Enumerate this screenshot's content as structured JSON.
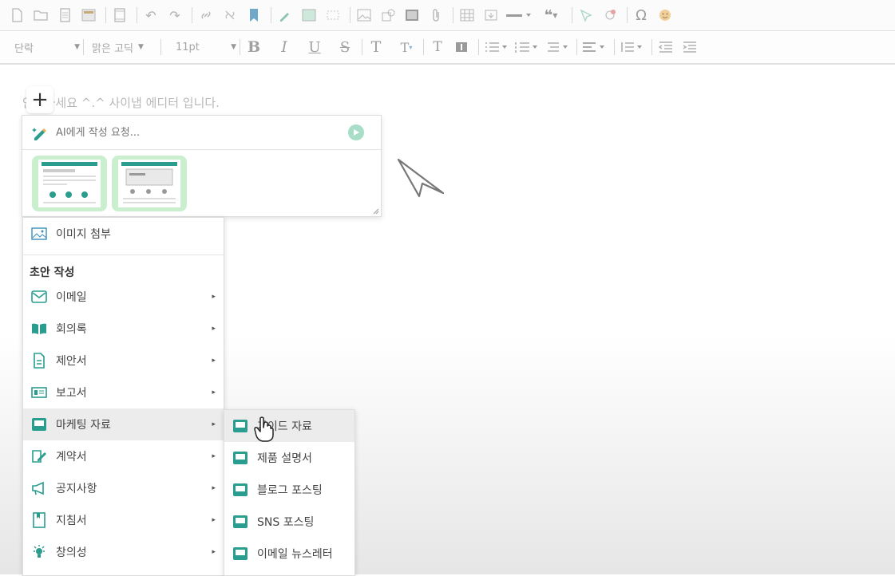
{
  "toolbar": {
    "row1_icons": [
      "new-document-icon",
      "open-folder-icon",
      "document-icon",
      "template-icon",
      "page-layout-icon",
      "undo-icon",
      "redo-icon",
      "link-icon",
      "unlink-icon",
      "bookmark-icon",
      "ai-write-icon",
      "image-insert-icon",
      "crop-icon",
      "picture-icon",
      "shapes-icon",
      "video-icon",
      "attachment-icon",
      "table-icon",
      "embed-icon",
      "horizontal-rule-icon",
      "quote-icon",
      "tag-icon",
      "special-char-icon",
      "emoji-icon"
    ],
    "paragraph_style": "단락",
    "font_family": "맑은 고딕",
    "font_size": "11pt"
  },
  "editor": {
    "placeholder_text": "안녕하세요 ^.^ 사이냅 에디터 입니다.",
    "add_block_symbol": "+"
  },
  "ai_panel": {
    "input_placeholder": "AI에게 작성 요청...",
    "colors": {
      "accent": "#2a9d8f",
      "thumb_bg": "#c9efcf",
      "send": "#a8dec8"
    }
  },
  "menu": {
    "attach_image": "이미지 첨부",
    "section_title": "초안 작성",
    "items": [
      {
        "label": "이메일",
        "icon": "mail-icon"
      },
      {
        "label": "회의록",
        "icon": "book-icon"
      },
      {
        "label": "제안서",
        "icon": "proposal-doc-icon"
      },
      {
        "label": "보고서",
        "icon": "report-icon"
      },
      {
        "label": "마케팅 자료",
        "icon": "marketing-icon"
      },
      {
        "label": "계약서",
        "icon": "contract-sign-icon"
      },
      {
        "label": "공지사항",
        "icon": "megaphone-icon"
      },
      {
        "label": "지침서",
        "icon": "guide-icon"
      },
      {
        "label": "창의성",
        "icon": "lightbulb-icon"
      }
    ],
    "submenu_arrow": "▸"
  },
  "submenu": {
    "items": [
      {
        "label": "가이드 자료"
      },
      {
        "label": "제품 설명서"
      },
      {
        "label": "블로그 포스팅"
      },
      {
        "label": "SNS 포스팅"
      },
      {
        "label": "이메일 뉴스레터"
      }
    ]
  }
}
